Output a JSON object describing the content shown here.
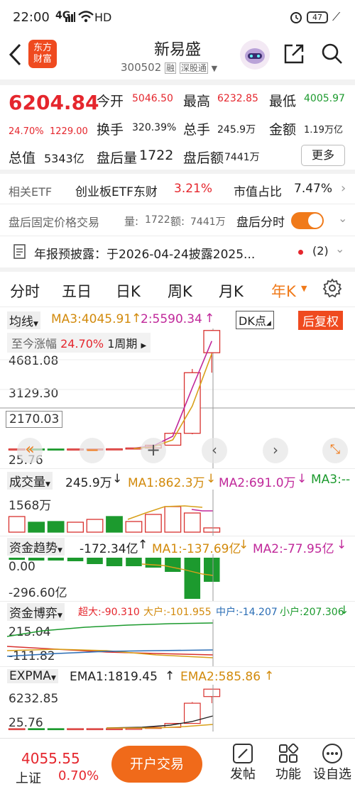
{
  "status_bar": {
    "time": "22:00",
    "signal": "4G",
    "hd": "HD",
    "battery": "47"
  },
  "header": {
    "logo_line1": "东方",
    "logo_line2": "财富",
    "title": "新易盛",
    "code": "300502",
    "badge1": "融",
    "badge2": "深股通"
  },
  "quote": {
    "price": "6204.84",
    "pct": "24.70%",
    "change": "1229.00",
    "open_label": "今开",
    "open": "5046.50",
    "high_label": "最高",
    "high": "6232.85",
    "low_label": "最低",
    "low": "4005.97",
    "turnover_label": "换手",
    "turnover": "320.39%",
    "volume_label": "总手",
    "volume": "245.9万",
    "amount_label": "金额",
    "amount": "1.19万亿",
    "mcap_label": "总值",
    "mcap": "5343亿",
    "after_vol_label": "盘后量",
    "after_vol": "1722",
    "after_amt_label": "盘后额",
    "after_amt": "7441万",
    "more": "更多"
  },
  "etf": {
    "label": "相关ETF",
    "name": "创业板ETF东财",
    "pct": "3.21%",
    "share_label": "市值占比",
    "share": "7.47%"
  },
  "after_hours": {
    "label": "盘后固定价格交易",
    "vol_label": "量:",
    "vol": "1722",
    "amt_label": "额:",
    "amt": "7441万",
    "toggle_label": "盘后分时"
  },
  "notice": {
    "text": "年报预披露：于2026-04-24披露2025...",
    "count": "(2)"
  },
  "tabs": [
    "分时",
    "五日",
    "日K",
    "周K",
    "月K",
    "年K"
  ],
  "active_tab": 5,
  "kline": {
    "ma_selector": "均线",
    "ma3": "MA3:4045.91",
    "ma2": "2:5590.34",
    "dk": "DK点",
    "restore": "后复权",
    "range_label": "至今涨幅",
    "range_pct": "24.70%",
    "range_period": "1周期",
    "y_top": "4681.08",
    "y_mid": "3129.30",
    "y_cross": "2170.03",
    "y_bottom": "25.76"
  },
  "volume": {
    "label": "成交量",
    "value": "245.9万",
    "ma1": "MA1:862.3万",
    "ma2": "MA2:691.0万",
    "ma3": "MA3:--",
    "y_top": "1568万"
  },
  "fund_trend": {
    "label": "资金趋势",
    "value": "-172.34亿",
    "ma1": "MA1:-137.69亿",
    "ma2": "MA2:-77.95亿",
    "y_top": "0.00",
    "y_bottom": "-296.60亿"
  },
  "fund_game": {
    "label": "资金博弈",
    "super": "超大:-90.310",
    "large": "大户:-101.955",
    "mid": "中户:-14.207",
    "small": "小户:207.306",
    "y_top": "215.04",
    "y_bottom": "-111.82"
  },
  "expma": {
    "label": "EXPMA",
    "ema1": "EMA1:1819.45",
    "ema2": "EMA2:585.86",
    "y_top": "6232.85",
    "y_bottom": "25.76"
  },
  "bottom_bar": {
    "index_value": "4055.55",
    "index_name": "上证",
    "index_pct": "0.70%",
    "trade": "开户交易",
    "post": "发帖",
    "func": "功能",
    "settings": "设自选"
  },
  "chart_data": {
    "type": "candlestick",
    "series": [
      {
        "name": "K",
        "ohlc": [
          [
            25.76,
            40,
            25.76,
            35
          ],
          [
            35,
            45,
            30,
            32
          ],
          [
            32,
            38,
            28,
            30
          ],
          [
            30,
            36,
            27,
            34
          ],
          [
            34,
            40,
            31,
            36
          ],
          [
            36,
            45,
            33,
            40
          ],
          [
            40,
            90,
            38,
            85
          ],
          [
            85,
            240,
            80,
            230
          ],
          [
            230,
            900,
            220,
            850
          ],
          [
            850,
            4200,
            800,
            4005.97
          ],
          [
            5046.5,
            6232.85,
            4005.97,
            6204.84
          ]
        ]
      }
    ]
  }
}
